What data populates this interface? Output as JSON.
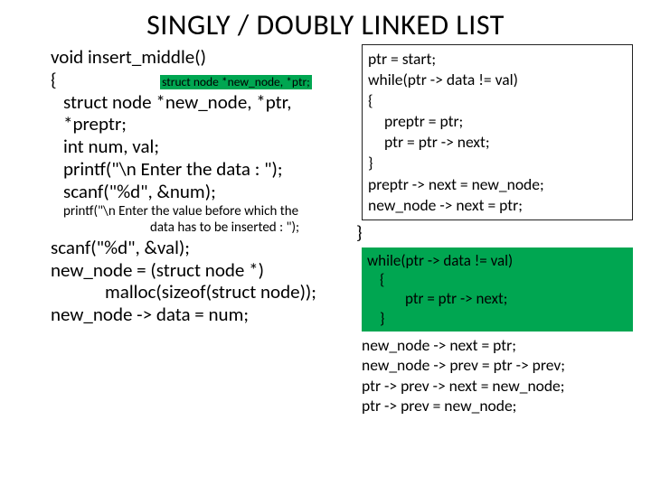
{
  "title": "SINGLY / DOUBLY LINKED LIST",
  "left": {
    "l1": "void insert_middle()",
    "l2_open": "{",
    "l2_struct": "struct node *new_node, *ptr;",
    "l3": "struct node *new_node, *ptr, *preptr;",
    "l4": "int num, val;",
    "l5": "printf(\"\\n Enter the data : \");",
    "l6": "scanf(\"%d\", &num);",
    "l7a": "printf(\"\\n Enter the value before which the",
    "l7b": "data has to be inserted : \");",
    "l8": "scanf(\"%d\", &val);",
    "l9": "new_node = (struct node *)",
    "l10": "malloc(sizeof(struct node));",
    "l11": "new_node -> data = num;"
  },
  "right": {
    "b1": "ptr = start;",
    "b2": "while(ptr -> data != val)",
    "b3": "{",
    "b4": "preptr = ptr;",
    "b5": "ptr = ptr -> next;",
    "b6": "}",
    "b7": "preptr -> next = new_node;",
    "b8": "new_node -> next = ptr;",
    "close": "}",
    "g1": "while(ptr -> data != val)",
    "g2": "{",
    "g3": "ptr = ptr -> next;",
    "g4": "}",
    "t1": "new_node -> next = ptr;",
    "t2": "new_node -> prev = ptr -> prev;",
    "t3": "ptr -> prev -> next = new_node;",
    "t4": "ptr -> prev  = new_node;"
  }
}
